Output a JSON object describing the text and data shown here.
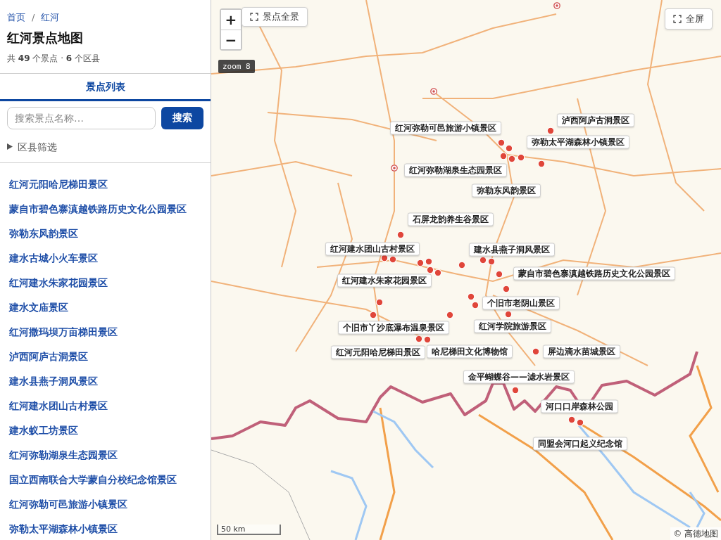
{
  "breadcrumb": {
    "items": [
      {
        "label": "首页"
      },
      {
        "label": "红河"
      }
    ],
    "separator": "/"
  },
  "title": "红河景点地图",
  "summary": "共 **49** 个景点 · **6** 个区县",
  "tabs": [
    {
      "label": "景点列表",
      "selected": true
    }
  ],
  "search": {
    "placeholder": "搜索景点名称…",
    "button": "搜索"
  },
  "filter": {
    "label": "区县筛选",
    "expanded": false
  },
  "attractions": [
    "红河元阳哈尼梯田景区",
    "蒙自市碧色寨滇越铁路历史文化公园景区",
    "弥勒东风韵景区",
    "建水古城小火车景区",
    "红河建水朱家花园景区",
    "建水文庙景区",
    "红河撒玛坝万亩梯田景区",
    "泸西阿庐古洞景区",
    "建水县燕子洞风景区",
    "红河建水团山古村景区",
    "建水蚁工坊景区",
    "红河弥勒湖泉生态园景区",
    "国立西南联合大学蒙自分校纪念馆景区",
    "红河弥勒可邑旅游小镇景区",
    "弥勒太平湖森林小镇景区"
  ],
  "map": {
    "zoom_in": "+",
    "zoom_out": "−",
    "overview_button": "景点全景",
    "fullscreen_button": "全屏",
    "zoom_badge": "zoom 8",
    "scale": "50 km",
    "attribution": "© 高德地图",
    "labels": [
      "泸西阿庐古洞景区",
      "红河弥勒可邑旅游小镇景区",
      "弥勒太平湖森林小镇景区",
      "红河弥勒湖泉生态园景区",
      "弥勒东风韵景区",
      "石屏龙韵养生谷景区",
      "红河建水团山古村景区",
      "建水县燕子洞风景区",
      "蒙自市碧色寨滇越铁路历史文化公园景区",
      "红河建水朱家花园景区",
      "个旧市老阴山景区",
      "个旧市丫沙底瀑布温泉景区",
      "红河学院旅游景区",
      "红河元阳哈尼梯田景区",
      "哈尼梯田文化博物馆",
      "屏边滴水苗城景区",
      "金平蝴蝶谷——滤水岩景区",
      "河口口岸森林公园",
      "同盟会河口起义纪念馆"
    ]
  }
}
